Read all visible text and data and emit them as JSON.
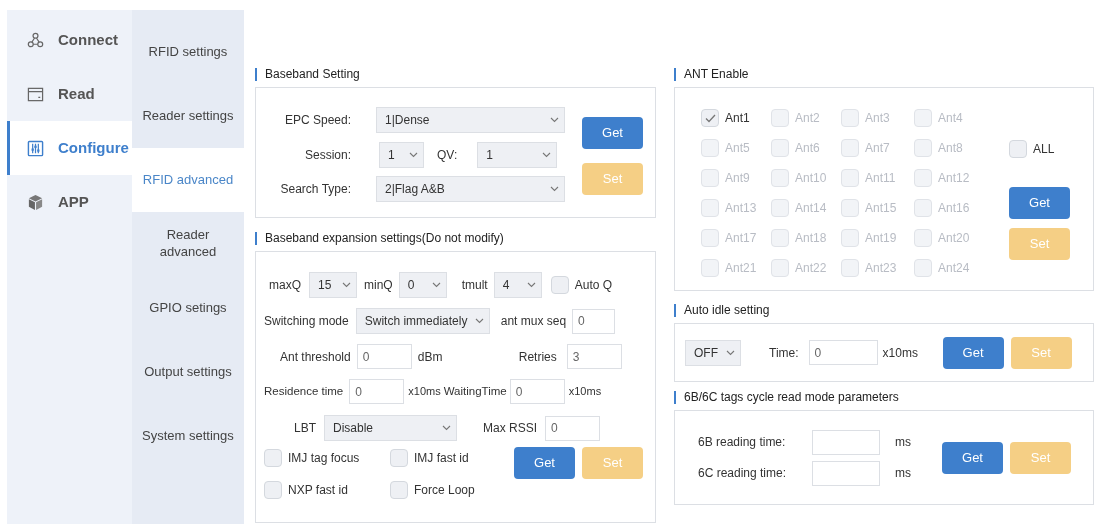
{
  "nav": [
    {
      "label": "Connect",
      "selected": false
    },
    {
      "label": "Read",
      "selected": false
    },
    {
      "label": "Configure",
      "selected": true
    },
    {
      "label": "APP",
      "selected": false
    }
  ],
  "subnav": [
    {
      "label": "RFID settings",
      "selected": false
    },
    {
      "label": "Reader settings",
      "selected": false
    },
    {
      "label": "RFID advanced",
      "selected": true
    },
    {
      "label": "Reader advanced",
      "selected": false
    },
    {
      "label": "GPIO setings",
      "selected": false
    },
    {
      "label": "Output settings",
      "selected": false
    },
    {
      "label": "System settings",
      "selected": false
    }
  ],
  "baseband": {
    "title": "Baseband Setting",
    "epc_speed": {
      "label": "EPC Speed:",
      "value": "1|Dense"
    },
    "session": {
      "label": "Session:",
      "value": "1"
    },
    "qv": {
      "label": "QV:",
      "value": "1"
    },
    "search_type": {
      "label": "Search Type:",
      "value": "2|Flag A&B"
    },
    "buttons": [
      {
        "label": "Get",
        "kind": "get"
      },
      {
        "label": "Set",
        "kind": "set"
      }
    ]
  },
  "expansion": {
    "title": "Baseband expansion settings(Do not modify)",
    "maxq": {
      "label": "maxQ",
      "value": "15"
    },
    "minq": {
      "label": "minQ",
      "value": "0"
    },
    "tmult": {
      "label": "tmult",
      "value": "4"
    },
    "auto_q": {
      "label": "Auto Q",
      "checked": false
    },
    "switching_mode": {
      "label": "Switching mode",
      "value": "Switch immediately"
    },
    "ant_mux_seq": {
      "label": "ant mux seq",
      "value": "0"
    },
    "ant_threshold": {
      "label": "Ant threshold",
      "value": "0",
      "unit": "dBm"
    },
    "retries": {
      "label": "Retries",
      "value": "3"
    },
    "residence_time": {
      "label": "Residence time",
      "value": "0",
      "unit": "x10ms"
    },
    "waiting_time": {
      "label": "WaitingTime",
      "value": "0",
      "unit": "x10ms"
    },
    "lbt": {
      "label": "LBT",
      "value": "Disable"
    },
    "max_rssi": {
      "label": "Max RSSI",
      "value": "0"
    },
    "options": [
      {
        "label": "IMJ tag focus",
        "checked": false
      },
      {
        "label": "IMJ fast id",
        "checked": false
      },
      {
        "label": "NXP fast id",
        "checked": false
      },
      {
        "label": "Force Loop",
        "checked": false
      }
    ],
    "buttons": [
      {
        "label": "Get",
        "kind": "get"
      },
      {
        "label": "Set",
        "kind": "set"
      }
    ]
  },
  "ant_enable": {
    "title": "ANT Enable",
    "antennas": [
      {
        "label": "Ant1",
        "checked": true,
        "disabled": false
      },
      {
        "label": "Ant2",
        "checked": false,
        "disabled": true
      },
      {
        "label": "Ant3",
        "checked": false,
        "disabled": true
      },
      {
        "label": "Ant4",
        "checked": false,
        "disabled": true
      },
      {
        "label": "Ant5",
        "checked": false,
        "disabled": true
      },
      {
        "label": "Ant6",
        "checked": false,
        "disabled": true
      },
      {
        "label": "Ant7",
        "checked": false,
        "disabled": true
      },
      {
        "label": "Ant8",
        "checked": false,
        "disabled": true
      },
      {
        "label": "Ant9",
        "checked": false,
        "disabled": true
      },
      {
        "label": "Ant10",
        "checked": false,
        "disabled": true
      },
      {
        "label": "Ant11",
        "checked": false,
        "disabled": true
      },
      {
        "label": "Ant12",
        "checked": false,
        "disabled": true
      },
      {
        "label": "Ant13",
        "checked": false,
        "disabled": true
      },
      {
        "label": "Ant14",
        "checked": false,
        "disabled": true
      },
      {
        "label": "Ant15",
        "checked": false,
        "disabled": true
      },
      {
        "label": "Ant16",
        "checked": false,
        "disabled": true
      },
      {
        "label": "Ant17",
        "checked": false,
        "disabled": true
      },
      {
        "label": "Ant18",
        "checked": false,
        "disabled": true
      },
      {
        "label": "Ant19",
        "checked": false,
        "disabled": true
      },
      {
        "label": "Ant20",
        "checked": false,
        "disabled": true
      },
      {
        "label": "Ant21",
        "checked": false,
        "disabled": true
      },
      {
        "label": "Ant22",
        "checked": false,
        "disabled": true
      },
      {
        "label": "Ant23",
        "checked": false,
        "disabled": true
      },
      {
        "label": "Ant24",
        "checked": false,
        "disabled": true
      }
    ],
    "all": {
      "label": "ALL",
      "checked": false
    },
    "buttons": [
      {
        "label": "Get",
        "kind": "get"
      },
      {
        "label": "Set",
        "kind": "set"
      }
    ]
  },
  "auto_idle": {
    "title": "Auto idle setting",
    "mode": {
      "value": "OFF"
    },
    "time": {
      "label": "Time:",
      "value": "0",
      "unit": "x10ms"
    },
    "buttons": [
      {
        "label": "Get",
        "kind": "get"
      },
      {
        "label": "Set",
        "kind": "set"
      }
    ]
  },
  "cycle_read": {
    "title": "6B/6C tags cycle read mode parameters",
    "fields": [
      {
        "label": "6B reading time:",
        "unit": "ms"
      },
      {
        "label": "6C reading time:",
        "unit": "ms"
      }
    ],
    "buttons": [
      {
        "label": "Get",
        "kind": "get"
      },
      {
        "label": "Set",
        "kind": "set"
      }
    ]
  }
}
